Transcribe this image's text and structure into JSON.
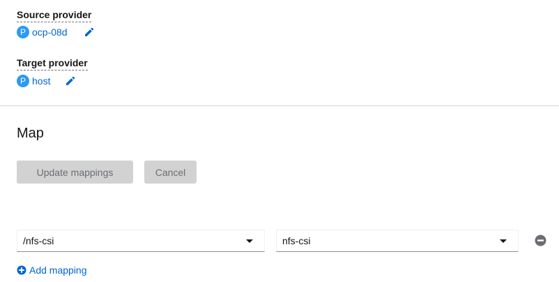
{
  "source_provider": {
    "label": "Source provider",
    "badge": "P",
    "name": "ocp-08d"
  },
  "target_provider": {
    "label": "Target provider",
    "badge": "P",
    "name": "host"
  },
  "map": {
    "title": "Map",
    "update_label": "Update mappings",
    "cancel_label": "Cancel",
    "mappings": [
      {
        "source": "/nfs-csi",
        "target": "nfs-csi"
      }
    ],
    "add_mapping_label": "Add mapping"
  },
  "colors": {
    "link": "#0066cc",
    "badge": "#2b9af3",
    "disabled_button_bg": "#d2d2d2",
    "disabled_button_text": "#6a6e73"
  },
  "icons": {
    "edit": "pencil-icon",
    "remove": "minus-circle-icon",
    "add": "plus-circle-icon",
    "caret": "caret-down-icon"
  }
}
